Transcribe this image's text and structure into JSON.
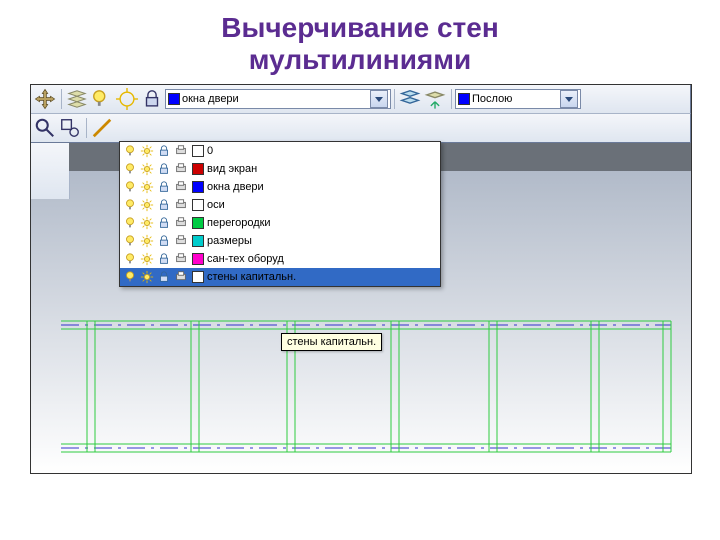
{
  "title_line1": "Вычерчивание стен",
  "title_line2": "мультилиниями",
  "current_layer": {
    "swatch": "#0000ff",
    "label": "окна двери"
  },
  "color_box": {
    "swatch": "#0000ff",
    "label": "Послою"
  },
  "layers": [
    {
      "swatch": "#ffffff",
      "label": "0",
      "selected": false
    },
    {
      "swatch": "#cc0000",
      "label": "вид экран",
      "selected": false
    },
    {
      "swatch": "#0000ff",
      "label": "окна двери",
      "selected": false
    },
    {
      "swatch": "#ffffff",
      "label": "оси",
      "selected": false
    },
    {
      "swatch": "#00cc44",
      "label": "перегородки",
      "selected": false
    },
    {
      "swatch": "#00cccc",
      "label": "размеры",
      "selected": false
    },
    {
      "swatch": "#ff00cc",
      "label": "сан-тех оборуд",
      "selected": false
    },
    {
      "swatch": "#ffffff",
      "label": "стены капитальн.",
      "selected": true
    }
  ],
  "tooltip": "стены капитальн.",
  "icons": {
    "layermgr": "layer-manager-icon",
    "freeze": "snowflake-icon",
    "bulb": "lightbulb-icon",
    "sun": "sun-icon",
    "lock": "lock-icon",
    "plot": "printer-icon"
  }
}
